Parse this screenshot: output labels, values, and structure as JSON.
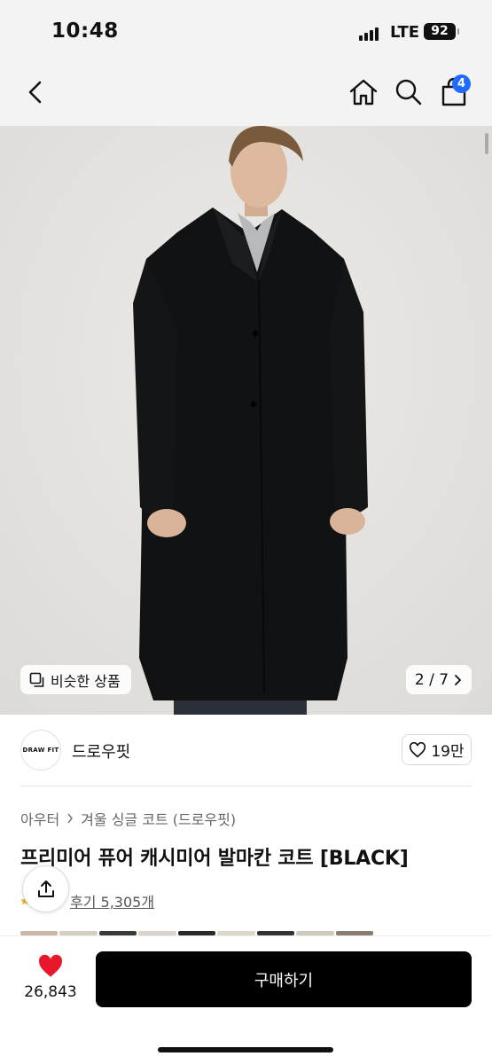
{
  "status": {
    "time": "10:48",
    "network": "LTE",
    "battery": "92"
  },
  "nav": {
    "cart_count": "4"
  },
  "gallery": {
    "similar_label": "비슷한 상품",
    "page": "2 / 7"
  },
  "brand": {
    "logo_text": "DRAW FIT",
    "name": "드로우핏",
    "likes": "19만"
  },
  "product": {
    "breadcrumb": [
      "아우터",
      "겨울 싱글 코트 (드로우핏)"
    ],
    "title": "프리미어 퓨어 캐시미어 발마칸 코트 [BLACK]",
    "reviews": "후기 5,305개"
  },
  "bottom": {
    "wish_count": "26,843",
    "buy_label": "구매하기"
  },
  "colors": {
    "accent": "#1f6bff",
    "heart": "#e8172b",
    "buy_bg": "#000000"
  }
}
